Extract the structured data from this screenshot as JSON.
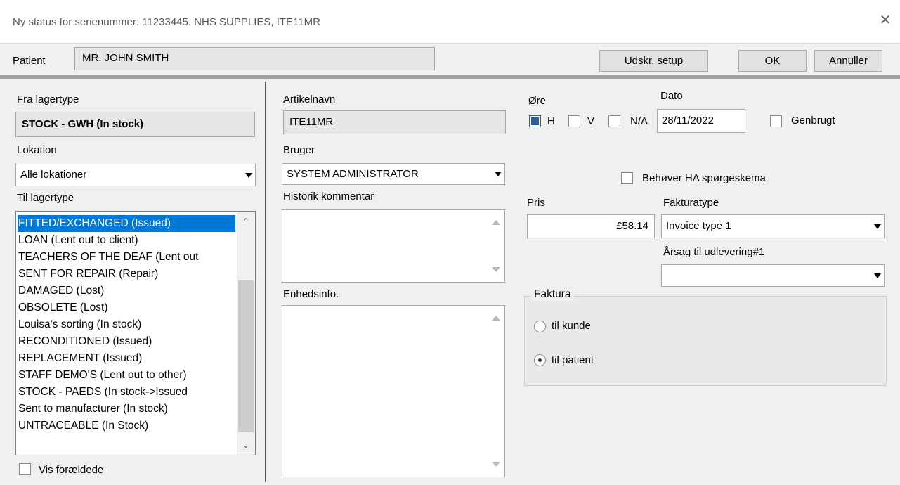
{
  "window": {
    "title": "Ny status for serienummer: 11233445.  NHS SUPPLIES, ITE11MR",
    "close": "✕"
  },
  "header": {
    "patient_label": "Patient",
    "patient_value": "MR. JOHN SMITH",
    "print_setup": "Udskr. setup",
    "ok": "OK",
    "cancel": "Annuller"
  },
  "left": {
    "from_stock_label": "Fra lagertype",
    "from_stock_value": "STOCK - GWH (In stock)",
    "location_label": "Lokation",
    "location_value": "Alle lokationer",
    "to_stock_label": "Til lagertype",
    "to_stock_items": [
      "FITTED/EXCHANGED (Issued)",
      "LOAN (Lent out to client)",
      "TEACHERS OF THE DEAF (Lent out",
      "SENT FOR REPAIR (Repair)",
      "DAMAGED (Lost)",
      "OBSOLETE (Lost)",
      "Louisa's sorting (In stock)",
      "RECONDITIONED (Issued)",
      "REPLACEMENT (Issued)",
      "STAFF DEMO'S (Lent out to other)",
      "STOCK - PAEDS (In stock->Issued",
      "Sent to manufacturer (In stock)",
      "UNTRACEABLE (In Stock)"
    ],
    "to_stock_selected": 0,
    "show_obsolete_label": "Vis forældede",
    "show_obsolete_checked": false
  },
  "middle": {
    "article_label": "Artikelnavn",
    "article_value": "ITE11MR",
    "user_label": "Bruger",
    "user_value": "SYSTEM ADMINISTRATOR",
    "history_comment_label": "Historik kommentar",
    "history_comment_value": "",
    "unit_info_label": "Enhedsinfo.",
    "unit_info_value": ""
  },
  "right": {
    "ear_label": "Øre",
    "ear_options": [
      {
        "label": "H",
        "checked": true
      },
      {
        "label": "V",
        "checked": false
      },
      {
        "label": "N/A",
        "checked": false
      }
    ],
    "date_label": "Dato",
    "date_value": "28/11/2022",
    "recycled_label": "Genbrugt",
    "recycled_checked": false,
    "needs_ha_label": "Behøver HA spørgeskema",
    "needs_ha_checked": false,
    "price_label": "Pris",
    "price_value": "£58.14",
    "invoice_type_label": "Fakturatype",
    "invoice_type_value": "Invoice type 1",
    "reason_label": "Årsag til udlevering#1",
    "reason_value": "",
    "invoice_group_label": "Faktura",
    "invoice_options": [
      {
        "label": "til kunde",
        "selected": false
      },
      {
        "label": "til patient",
        "selected": true
      }
    ]
  },
  "colors": {
    "selection": "#0078d7",
    "checked_box": "#2b5f9c",
    "background": "#f0f0f0"
  }
}
